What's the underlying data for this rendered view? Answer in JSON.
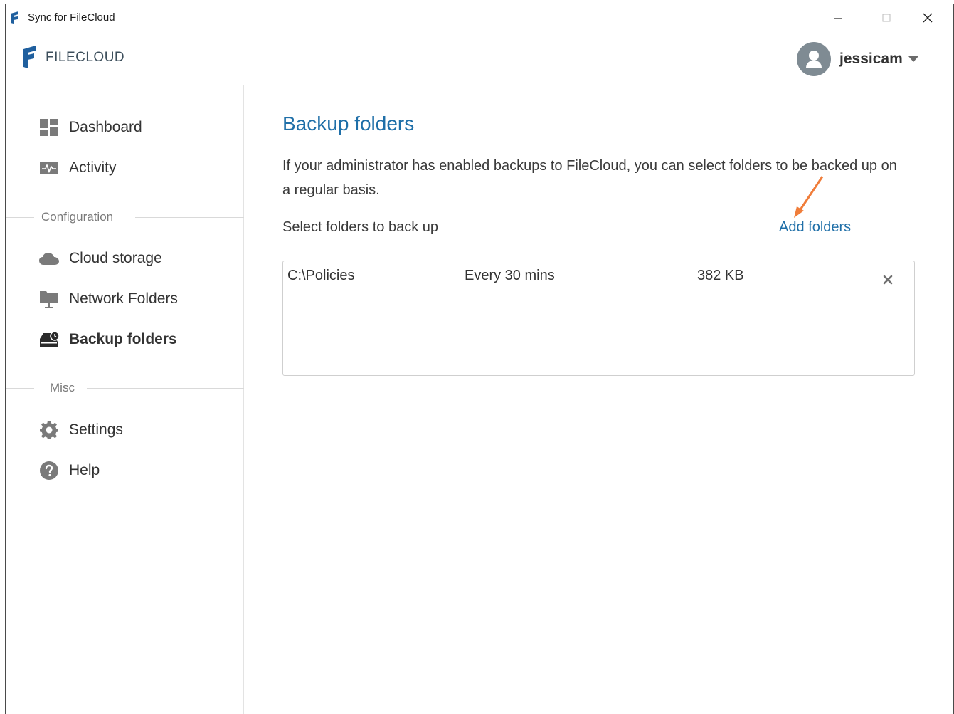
{
  "window": {
    "title": "Sync for FileCloud"
  },
  "header": {
    "logo_text": "FILECLOUD",
    "username": "jessicam"
  },
  "sidebar": {
    "items": [
      {
        "label": "Dashboard",
        "icon": "dashboard-icon"
      },
      {
        "label": "Activity",
        "icon": "activity-icon"
      },
      {
        "label": "Cloud storage",
        "icon": "cloud-icon"
      },
      {
        "label": "Network Folders",
        "icon": "network-folder-icon"
      },
      {
        "label": "Backup folders",
        "icon": "backup-icon",
        "active": true
      },
      {
        "label": "Settings",
        "icon": "gear-icon"
      },
      {
        "label": "Help",
        "icon": "help-icon"
      }
    ],
    "sections": {
      "configuration": "Configuration",
      "misc": "Misc"
    }
  },
  "main": {
    "title": "Backup folders",
    "description": "If your administrator has enabled backups to FileCloud, you can select folders to be backed up on a regular basis.",
    "select_label": "Select folders to back up",
    "add_link": "Add folders",
    "folders": [
      {
        "path": "C:\\Policies",
        "frequency": "Every 30 mins",
        "size": "382 KB"
      }
    ]
  },
  "colors": {
    "accent": "#1f6fa8",
    "annotation_arrow": "#f07d3a",
    "avatar_bg": "#7f8b93",
    "logo_blue": "#1f5f9e"
  }
}
